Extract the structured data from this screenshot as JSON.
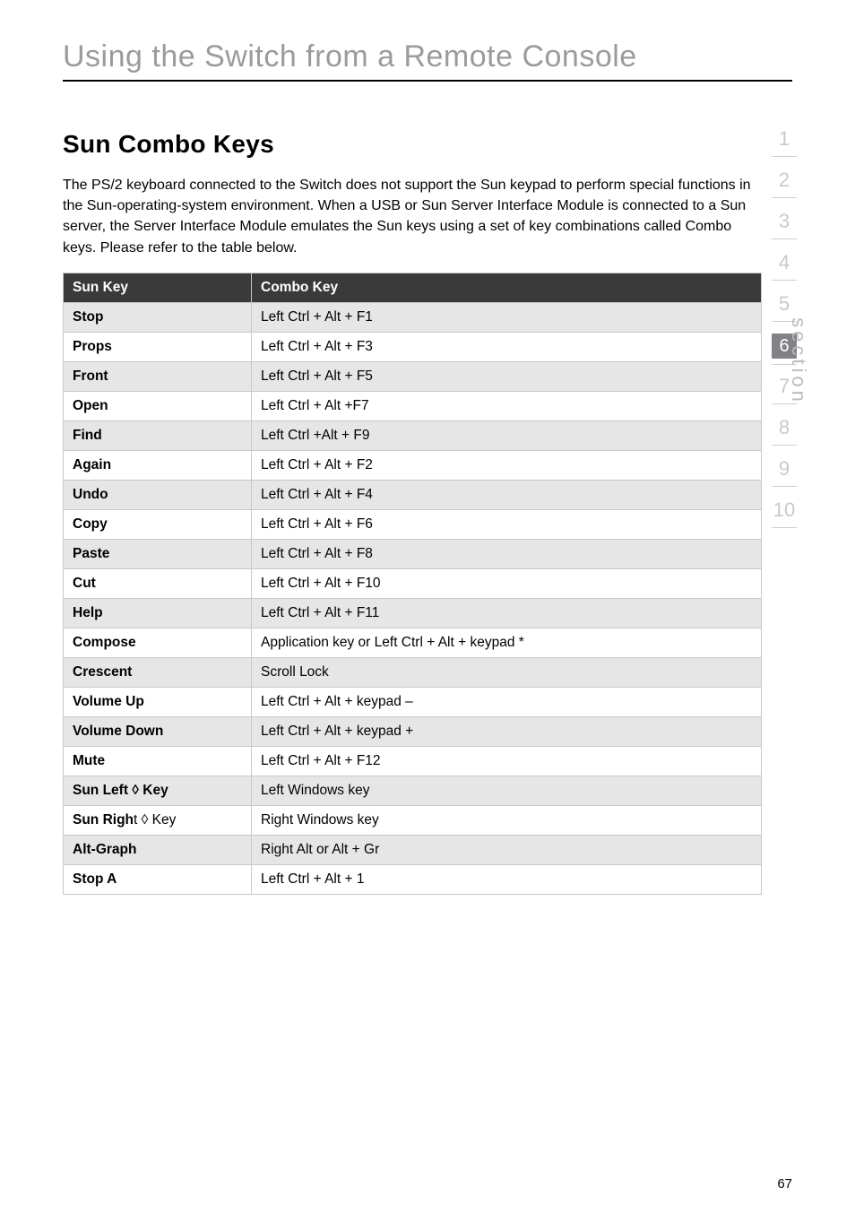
{
  "page_title": "Using the Switch from a Remote Console",
  "section_title": "Sun Combo Keys",
  "intro": "The PS/2 keyboard connected to the Switch does not support the Sun keypad to perform special functions in the Sun-operating-system environment. When a USB or Sun Server Interface Module is connected to a Sun server, the Server Interface Module emulates the Sun keys using a set of key combinations called Combo keys. Please refer to the table below.",
  "table": {
    "headers": [
      "Sun Key",
      "Combo Key"
    ],
    "rows": [
      {
        "key": "Stop",
        "combo": "Left Ctrl + Alt + F1",
        "shade": true
      },
      {
        "key": "Props",
        "combo": "Left Ctrl + Alt + F3",
        "shade": false
      },
      {
        "key": "Front",
        "combo": "Left Ctrl + Alt + F5",
        "shade": true
      },
      {
        "key": "Open",
        "combo": "Left Ctrl + Alt +F7",
        "shade": false
      },
      {
        "key": "Find",
        "combo": "Left Ctrl +Alt + F9",
        "shade": true
      },
      {
        "key": "Again",
        "combo": "Left Ctrl + Alt + F2",
        "shade": false
      },
      {
        "key": "Undo",
        "combo": "Left Ctrl + Alt + F4",
        "shade": true
      },
      {
        "key": "Copy",
        "combo": "Left Ctrl + Alt + F6",
        "shade": false
      },
      {
        "key": "Paste",
        "combo": "Left Ctrl + Alt + F8",
        "shade": true
      },
      {
        "key": "Cut",
        "combo": "Left Ctrl + Alt + F10",
        "shade": false
      },
      {
        "key": "Help",
        "combo": "Left Ctrl + Alt + F11",
        "shade": true
      },
      {
        "key": "Compose",
        "combo": "Application key or Left Ctrl + Alt + keypad *",
        "shade": false
      },
      {
        "key": "Crescent",
        "combo": "Scroll Lock",
        "shade": true
      },
      {
        "key": "Volume Up",
        "combo": "Left Ctrl + Alt + keypad –",
        "shade": false
      },
      {
        "key": "Volume Down",
        "combo": "Left Ctrl + Alt + keypad +",
        "shade": true
      },
      {
        "key": "Mute",
        "combo": "Left Ctrl + Alt + F12",
        "shade": false
      },
      {
        "key": "Sun Left ◊ Key",
        "combo": "Left Windows key",
        "shade": true
      },
      {
        "key": "Sun Right ◊ Key",
        "combo": "Right Windows key",
        "shade": false
      },
      {
        "key": "Alt-Graph",
        "combo": "Right Alt or Alt + Gr",
        "shade": true
      },
      {
        "key": "Stop A",
        "combo": "Left Ctrl + Alt + 1",
        "shade": false
      }
    ]
  },
  "nav": {
    "items": [
      "1",
      "2",
      "3",
      "4",
      "5",
      "6",
      "7",
      "8",
      "9",
      "10"
    ],
    "active_index": 5,
    "label": "section"
  },
  "page_number": "67"
}
